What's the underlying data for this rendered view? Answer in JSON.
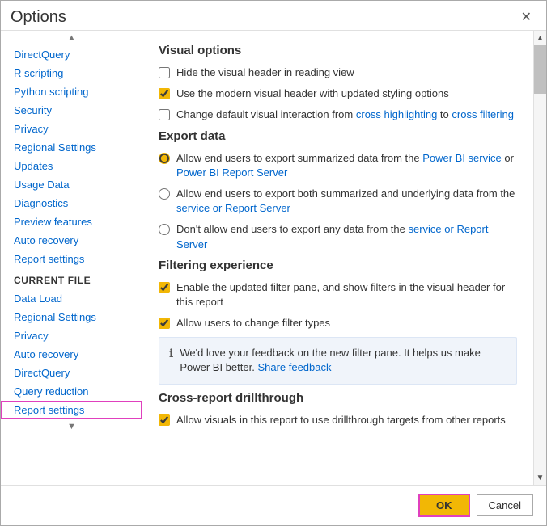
{
  "dialog": {
    "title": "Options",
    "close_label": "✕"
  },
  "sidebar": {
    "global_items": [
      {
        "label": "DirectQuery",
        "id": "directquery"
      },
      {
        "label": "R scripting",
        "id": "rscripting"
      },
      {
        "label": "Python scripting",
        "id": "pythonscripting"
      },
      {
        "label": "Security",
        "id": "security"
      },
      {
        "label": "Privacy",
        "id": "privacy"
      },
      {
        "label": "Regional Settings",
        "id": "regionalsettings"
      },
      {
        "label": "Updates",
        "id": "updates"
      },
      {
        "label": "Usage Data",
        "id": "usagedata"
      },
      {
        "label": "Diagnostics",
        "id": "diagnostics"
      },
      {
        "label": "Preview features",
        "id": "previewfeatures"
      },
      {
        "label": "Auto recovery",
        "id": "autorecovery"
      },
      {
        "label": "Report settings",
        "id": "reportsettings"
      }
    ],
    "current_file_header": "CURRENT FILE",
    "current_file_items": [
      {
        "label": "Data Load",
        "id": "dataload"
      },
      {
        "label": "Regional Settings",
        "id": "cf-regionalsettings"
      },
      {
        "label": "Privacy",
        "id": "cf-privacy"
      },
      {
        "label": "Auto recovery",
        "id": "cf-autorecovery"
      },
      {
        "label": "DirectQuery",
        "id": "cf-directquery"
      },
      {
        "label": "Query reduction",
        "id": "cf-queryreduction"
      },
      {
        "label": "Report settings",
        "id": "cf-reportsettings",
        "selected": true
      }
    ]
  },
  "main": {
    "sections": [
      {
        "id": "visual-options",
        "title": "Visual options",
        "options": [
          {
            "id": "hide-visual-header",
            "type": "checkbox",
            "checked": false,
            "label": "Hide the visual header in reading view"
          },
          {
            "id": "modern-visual-header",
            "type": "checkbox",
            "checked": true,
            "label": "Use the modern visual header with updated styling options"
          },
          {
            "id": "change-default-interaction",
            "type": "checkbox",
            "checked": false,
            "label": "Change default visual interaction from cross highlighting to cross filtering"
          }
        ]
      },
      {
        "id": "export-data",
        "title": "Export data",
        "options": [
          {
            "id": "export-summarized",
            "type": "radio",
            "checked": true,
            "label": "Allow end users to export summarized data from the Power BI service or Power BI Report Server"
          },
          {
            "id": "export-both",
            "type": "radio",
            "checked": false,
            "label": "Allow end users to export both summarized and underlying data from the service or Report Server"
          },
          {
            "id": "dont-allow-export",
            "type": "radio",
            "checked": false,
            "label": "Don't allow end users to export any data from the service or Report Server"
          }
        ]
      },
      {
        "id": "filtering-experience",
        "title": "Filtering experience",
        "options": [
          {
            "id": "filter-pane",
            "type": "checkbox",
            "checked": true,
            "label": "Enable the updated filter pane, and show filters in the visual header for this report"
          },
          {
            "id": "change-filter-types",
            "type": "checkbox",
            "checked": true,
            "label": "Allow users to change filter types"
          }
        ],
        "feedback": {
          "text": "We'd love your feedback on the new filter pane. It helps us make Power BI better.",
          "link_label": "Share feedback"
        }
      },
      {
        "id": "cross-report-drillthrough",
        "title": "Cross-report drillthrough",
        "options": [
          {
            "id": "allow-visuals-drillthrough",
            "type": "checkbox",
            "checked": true,
            "label": "Allow visuals in this report to use drillthrough targets from other reports"
          }
        ]
      }
    ]
  },
  "footer": {
    "ok_label": "OK",
    "cancel_label": "Cancel"
  }
}
